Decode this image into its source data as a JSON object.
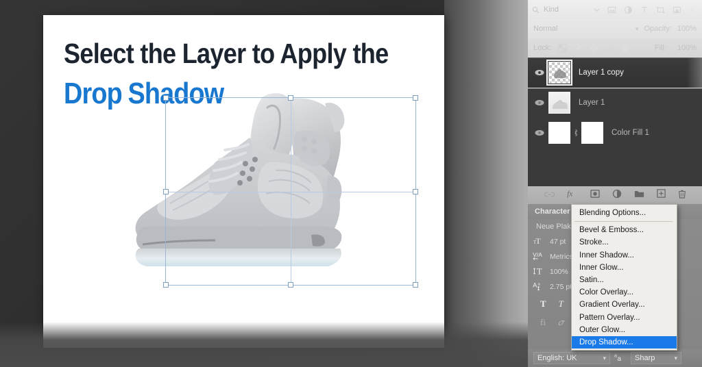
{
  "document": {
    "headline_line1": "Select the Layer to Apply the",
    "headline_line2_a": "Drop",
    "headline_line2_b": "Shadow",
    "accent_color": "#1878cf",
    "heading_color": "#1c2430",
    "artwork_alt": "grey sneaker"
  },
  "layers_panel": {
    "filter": {
      "search_label": "Kind",
      "icons": [
        "search-icon",
        "pixel-layer-icon",
        "adjustment-layer-icon",
        "type-layer-icon",
        "shape-layer-icon",
        "smart-object-icon",
        "filter-toggle-icon"
      ]
    },
    "blend": {
      "mode": "Normal",
      "opacity_label": "Opacity:",
      "opacity_value": "100%"
    },
    "lock": {
      "label": "Lock:",
      "icons": [
        "lock-transparency-icon",
        "lock-image-icon",
        "lock-position-icon",
        "lock-artboard-icon",
        "lock-all-icon"
      ],
      "fill_label": "Fill:",
      "fill_value": "100%"
    },
    "layers": [
      {
        "name": "Layer 1 copy",
        "visible": true,
        "selected": true,
        "thumb": "checker"
      },
      {
        "name": "Layer 1",
        "visible": true,
        "selected": false,
        "thumb": "shoe"
      },
      {
        "name": "Color Fill 1",
        "visible": true,
        "selected": false,
        "thumb": "solid",
        "has_mask": true
      }
    ],
    "tools": [
      "link-layers-icon",
      "fx-icon",
      "add-mask-icon",
      "adjustment-icon",
      "new-group-icon",
      "new-layer-icon",
      "delete-layer-icon"
    ]
  },
  "character_panel": {
    "title": "Character",
    "font_family": "Neue Plak",
    "rows": [
      {
        "icon": "font-size-icon",
        "value": "47 pt"
      },
      {
        "icon": "kerning-icon",
        "value": "Metrics"
      },
      {
        "icon": "vertical-scale-icon",
        "value": "100%"
      },
      {
        "icon": "baseline-shift-icon",
        "value": "2.75 pt"
      }
    ],
    "style_buttons": [
      "bold-icon",
      "italic-icon",
      "all-caps-icon",
      "small-caps-icon",
      "superscript-icon",
      "subscript-icon"
    ],
    "style_buttons2": [
      "standard-ligatures-icon",
      "contextual-alternates-icon",
      "swash-icon",
      "stylistic-alternates-icon",
      "titling-alternates-icon",
      "ordinals-icon",
      "fractions-icon"
    ],
    "language": "English: UK",
    "antialias_icon": "anti-aliasing-icon",
    "antialias": "Sharp"
  },
  "context_menu": {
    "items": [
      {
        "label": "Blending Options...",
        "highlighted": false,
        "separator_after": true
      },
      {
        "label": "Bevel & Emboss...",
        "highlighted": false
      },
      {
        "label": "Stroke...",
        "highlighted": false
      },
      {
        "label": "Inner Shadow...",
        "highlighted": false
      },
      {
        "label": "Inner Glow...",
        "highlighted": false
      },
      {
        "label": "Satin...",
        "highlighted": false
      },
      {
        "label": "Color Overlay...",
        "highlighted": false
      },
      {
        "label": "Gradient Overlay...",
        "highlighted": false
      },
      {
        "label": "Pattern Overlay...",
        "highlighted": false
      },
      {
        "label": "Outer Glow...",
        "highlighted": false
      },
      {
        "label": "Drop Shadow...",
        "highlighted": true
      }
    ],
    "highlight_color": "#1a7ae8"
  }
}
